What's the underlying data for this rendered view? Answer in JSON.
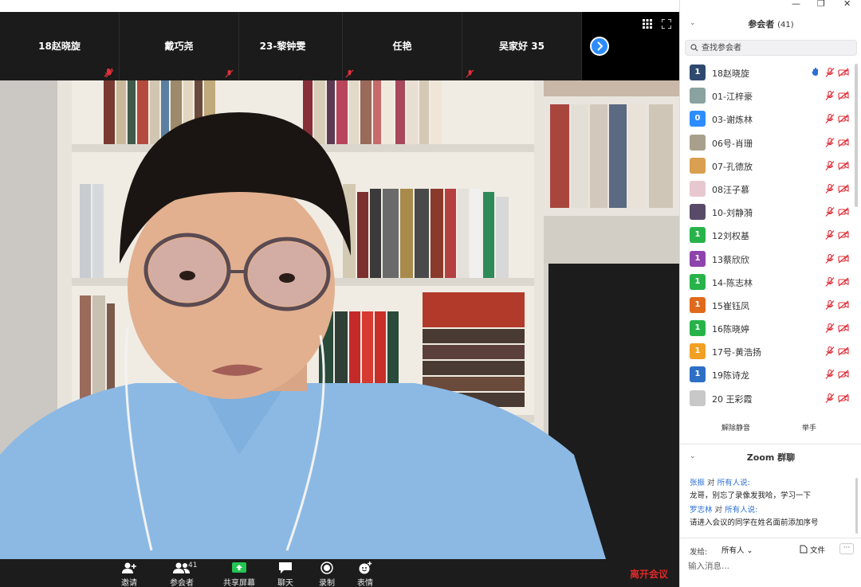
{
  "strip": {
    "tiles": [
      {
        "name": "18赵晓旋"
      },
      {
        "name": "戴巧尧"
      },
      {
        "name": "23-黎钟雯"
      },
      {
        "name": "任艳"
      },
      {
        "name": "吴家好 35"
      }
    ]
  },
  "toolbar": {
    "invite": "邀请",
    "participants": "参会者",
    "participants_count": "41",
    "share": "共享屏幕",
    "chat": "聊天",
    "record": "录制",
    "reactions": "表情",
    "leave": "离开会议"
  },
  "panel": {
    "title": "参会者",
    "count": "(41)",
    "search_placeholder": "查找参会者",
    "participants": [
      {
        "name": "18赵晓旋",
        "avatar_text": "1",
        "avatar_color": "#2f4a6e",
        "hand": true
      },
      {
        "name": "01-江梓豪",
        "avatar_text": "",
        "avatar_color": "#8aa2a0",
        "hand": false
      },
      {
        "name": "03-谢炼林",
        "avatar_text": "0",
        "avatar_color": "#2d8cff",
        "hand": false
      },
      {
        "name": "06号-肖珊",
        "avatar_text": "",
        "avatar_color": "#a8a08c",
        "hand": false
      },
      {
        "name": "07-孔德放",
        "avatar_text": "",
        "avatar_color": "#d8a050",
        "hand": false
      },
      {
        "name": "08汪子慕",
        "avatar_text": "",
        "avatar_color": "#e8c8d0",
        "hand": false
      },
      {
        "name": "10-刘静漪",
        "avatar_text": "",
        "avatar_color": "#5a4a6a",
        "hand": false
      },
      {
        "name": "12刘权基",
        "avatar_text": "1",
        "avatar_color": "#28b34a",
        "hand": false
      },
      {
        "name": "13蔡欣欣",
        "avatar_text": "1",
        "avatar_color": "#8e44ad",
        "hand": false
      },
      {
        "name": "14-陈志林",
        "avatar_text": "1",
        "avatar_color": "#28b34a",
        "hand": false
      },
      {
        "name": "15崔钰凤",
        "avatar_text": "1",
        "avatar_color": "#e06a1c",
        "hand": false
      },
      {
        "name": "16陈晓婷",
        "avatar_text": "1",
        "avatar_color": "#28b34a",
        "hand": false
      },
      {
        "name": "17号-黄浩扬",
        "avatar_text": "1",
        "avatar_color": "#f2a024",
        "hand": false
      },
      {
        "name": "19陈诗龙",
        "avatar_text": "1",
        "avatar_color": "#2e6fc6",
        "hand": false
      },
      {
        "name": "20 王彩霞",
        "avatar_text": "",
        "avatar_color": "#c8c8c8",
        "hand": false
      }
    ],
    "unmute_all": "解除静音",
    "raise_hand": "举手"
  },
  "chat": {
    "title": "Zoom 群聊",
    "messages": [
      {
        "sender": "张振",
        "to_word": "对",
        "recipient": "所有人说:",
        "text": "龙哥，别忘了录像发我哈，学习一下"
      },
      {
        "sender": "罗志林",
        "to_word": "对",
        "recipient": "所有人说:",
        "text": "请进入会议的同学在姓名面前添加序号"
      }
    ],
    "send_to_label": "发给:",
    "send_to_value": "所有人",
    "file_label": "文件",
    "more_label": "···",
    "input_placeholder": "输入消息..."
  },
  "colors": {
    "accent": "#2d8cff",
    "leave": "#e02828",
    "mute_red": "#e0303a"
  }
}
